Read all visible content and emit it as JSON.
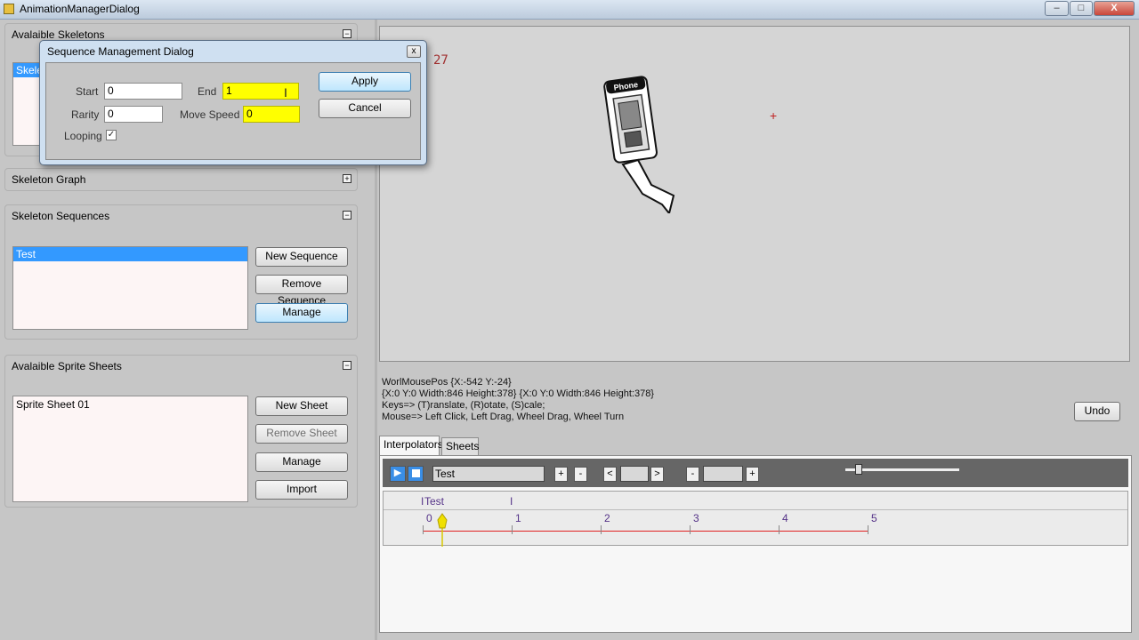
{
  "window": {
    "title": "AnimationManagerDialog",
    "min": "–",
    "max": "□",
    "close": "X"
  },
  "panels": {
    "skeletons": {
      "title": "Avalaible Skeletons",
      "toggle": "⊟",
      "item": "Skele"
    },
    "graph": {
      "title": "Skeleton Graph",
      "toggle": "⊞"
    },
    "sequences": {
      "title": "Skeleton Sequences",
      "toggle": "⊟",
      "items": [
        "Test"
      ],
      "buttons": {
        "new": "New Sequence",
        "remove": "Remove Sequence",
        "manage": "Manage"
      }
    },
    "sheets": {
      "title": "Avalaible Sprite Sheets",
      "toggle": "⊟",
      "items": [
        "Sprite Sheet 01"
      ],
      "buttons": {
        "new": "New Sheet",
        "remove": "Remove Sheet",
        "manage": "Manage",
        "import": "Import"
      }
    }
  },
  "viewport": {
    "frame_counter": "27",
    "sprite_label": "Phone"
  },
  "info": {
    "line1": "WorlMousePos {X:-542 Y:-24}",
    "line2": "{X:0 Y:0 Width:846 Height:378} {X:0 Y:0 Width:846 Height:378}",
    "line3": "Keys=> (T)ranslate, (R)otate, (S)cale;",
    "line4": "Mouse=> Left Click, Left Drag, Wheel Drag, Wheel Turn"
  },
  "undo_label": "Undo",
  "tabs": {
    "interpolators": "Interpolators",
    "sheets": "Sheets"
  },
  "timeline": {
    "sequence_name": "Test",
    "plus": "+",
    "minus": "-",
    "prev": "<",
    "next": ">",
    "track_label": "Test",
    "ticks": [
      "0",
      "1",
      "2",
      "3",
      "4",
      "5"
    ]
  },
  "dialog": {
    "title": "Sequence Management Dialog",
    "close": "x",
    "start_label": "Start",
    "start_value": "0",
    "end_label": "End",
    "end_value": "1",
    "rarity_label": "Rarity",
    "rarity_value": "0",
    "move_speed_label": "Move Speed",
    "move_speed_value": "0",
    "looping_label": "Looping",
    "looping_checked": "✓",
    "apply": "Apply",
    "cancel": "Cancel"
  },
  "colors": {
    "selection": "#3399ff",
    "highlight": "#ffff00",
    "timeline_line": "#e02020",
    "marker": "#f0e000"
  }
}
